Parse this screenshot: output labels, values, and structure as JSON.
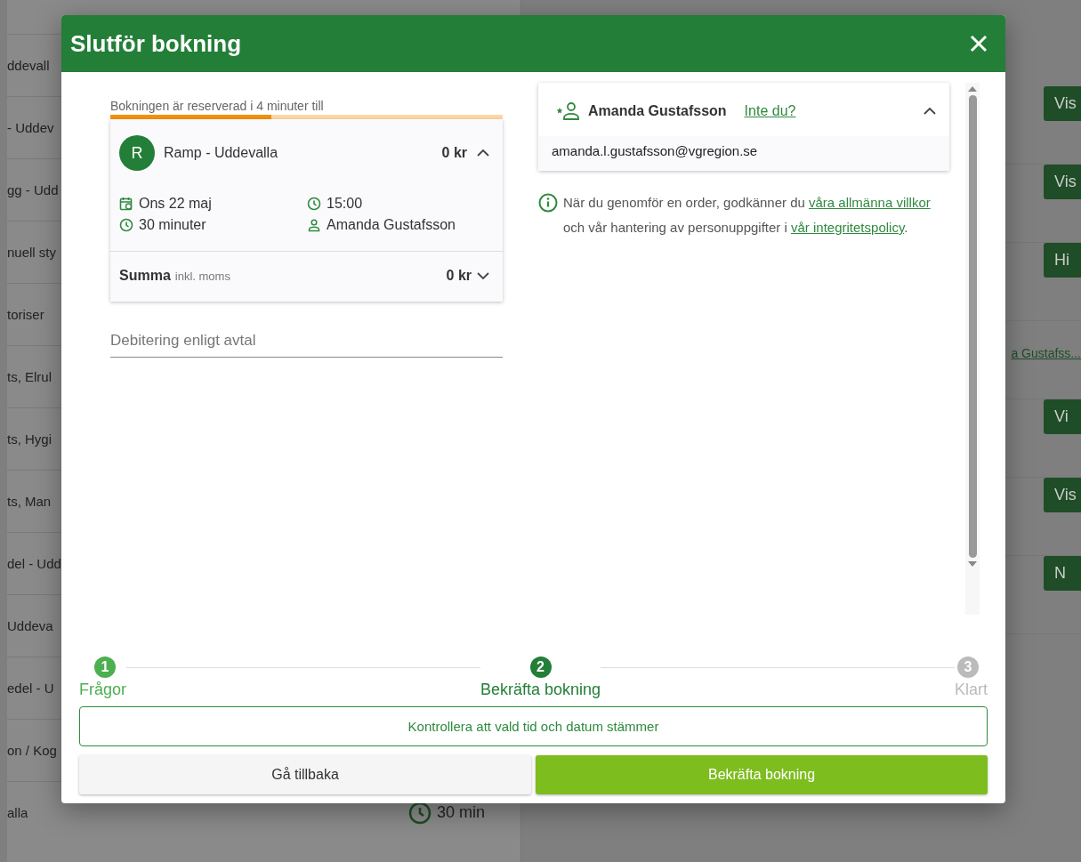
{
  "background": {
    "list_rows": [
      "ddevall",
      "- Uddev",
      "gg - Udd",
      "nuell sty",
      "toriser",
      "ts, Elrul",
      "ts, Hygi",
      "ts, Man",
      "del - Udd",
      "Uddeva",
      "edel - U",
      "on / Kog",
      "alla"
    ],
    "duration": "30 min",
    "action_buttons": [
      {
        "label": "Vis",
        "kind": "button"
      },
      {
        "label": "Vis",
        "kind": "button"
      },
      {
        "label": "Hi",
        "kind": "button"
      },
      {
        "label": "a Gustafss...",
        "kind": "link"
      },
      {
        "label": "Vi",
        "kind": "button"
      },
      {
        "label": "Vis",
        "kind": "button"
      },
      {
        "label": "N",
        "kind": "button"
      }
    ]
  },
  "modal": {
    "title": "Slutför bokning",
    "reservation": {
      "text": "Bokningen är reserverad i 4 minuter till",
      "level": 0.41
    },
    "booking": {
      "avatar": "R",
      "name": "Ramp - Uddevalla",
      "price": "0 kr",
      "expanded": true,
      "date": "Ons 22 maj",
      "time": "15:00",
      "duration": "30 minuter",
      "person": "Amanda Gustafsson"
    },
    "total": {
      "label": "Summa",
      "note": "inkl. moms",
      "price": "0 kr",
      "expanded": false
    },
    "billing": {
      "placeholder": "Debitering enligt avtal"
    },
    "user": {
      "name": "Amanda Gustafsson",
      "link": "Inte du?",
      "email": "amanda.l.gustafsson@vgregion.se",
      "expanded": true
    },
    "terms": [
      {
        "text": "När du genomför en order, godkänner du ",
        "link": false
      },
      {
        "text": "våra allmänna villkor",
        "link": true
      },
      {
        "text": " och vår hantering av personuppgifter i ",
        "link": false
      },
      {
        "text": "vår integritetspolicy",
        "link": true
      },
      {
        "text": ".",
        "link": false
      }
    ],
    "steps": [
      {
        "number": "1",
        "label": "Frågor",
        "done": true,
        "selected": false
      },
      {
        "number": "2",
        "label": "Bekräfta bokning",
        "done": false,
        "selected": true
      },
      {
        "number": "3",
        "label": "Klart",
        "done": false,
        "selected": false
      }
    ],
    "notice": "Kontrollera att vald tid och datum stämmer",
    "back_button": "Gå tillbaka",
    "confirm_button": "Bekräfta bokning"
  }
}
